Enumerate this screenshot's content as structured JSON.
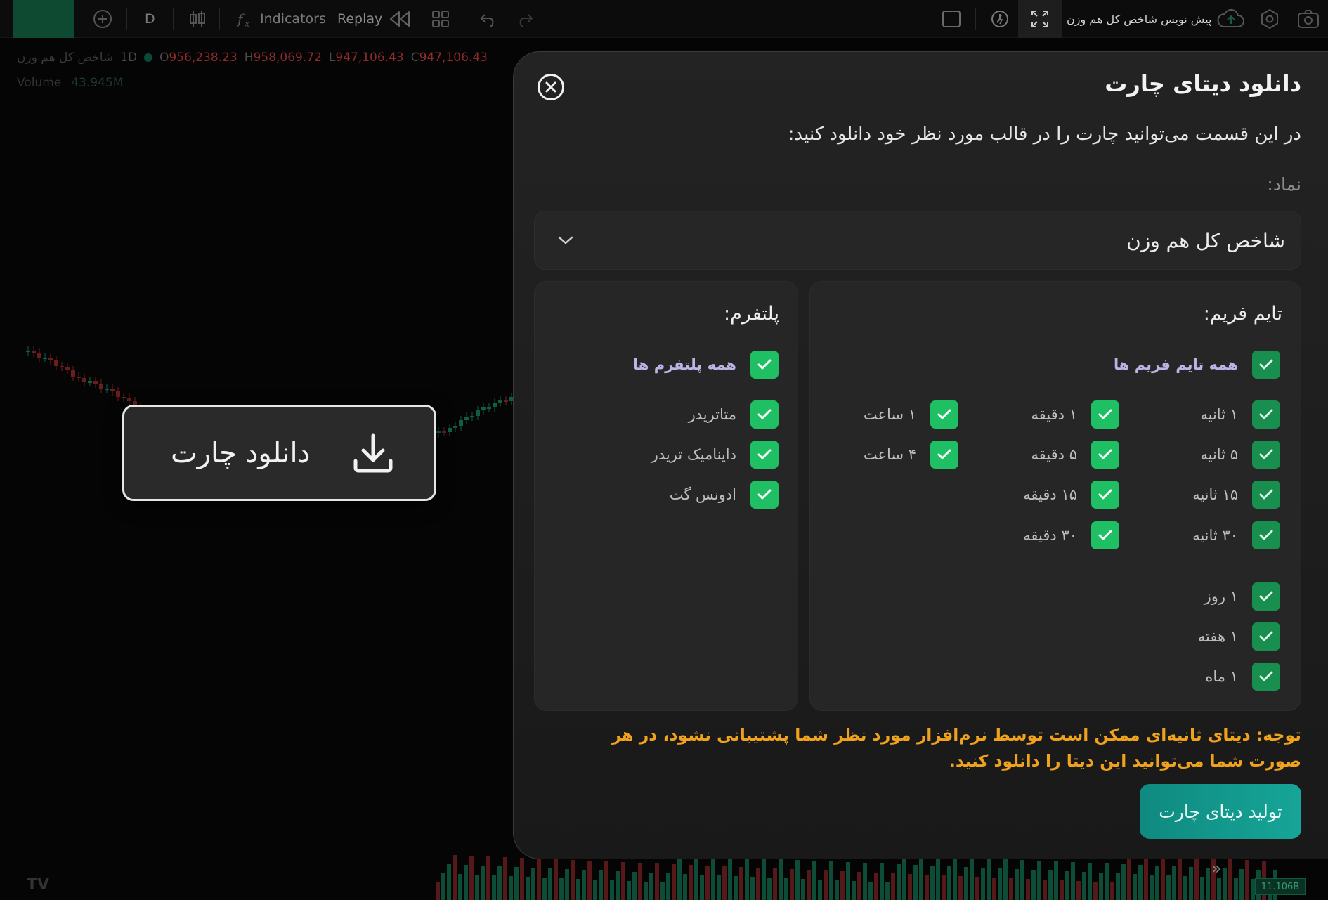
{
  "toolbar": {
    "timeframe": "D",
    "indicators_label": "Indicators",
    "replay_label": "Replay",
    "cloud_title": "پیش نویس شاخص کل هم وزن"
  },
  "legend": {
    "symbol": "شاخص کل هم وزن",
    "interval": "1D",
    "open_label": "O",
    "open": "956,238.23",
    "high_label": "H",
    "high": "958,069.72",
    "low_label": "L",
    "low": "947,106.43",
    "close_label": "C",
    "close": "947,106.43",
    "volume_label": "Volume",
    "volume": "43.945M"
  },
  "axis": {
    "current_value": "11.106B"
  },
  "download_button": {
    "label": "دانلود چارت"
  },
  "panel": {
    "title": "دانلود دیتای چارت",
    "description": "در این قسمت می‌توانید چارت را در قالب مورد نظر خود دانلود کنید:",
    "symbol_label": "نماد:",
    "symbol_value": "شاخص کل هم وزن",
    "timeframe_title": "تایم فریم:",
    "timeframe_all": "همه تایم فریم ها",
    "timeframes": {
      "s1": "۱ ثانیه",
      "s5": "۵ ثانیه",
      "s15": "۱۵ ثانیه",
      "s30": "۳۰ ثانیه",
      "m1": "۱ دقیقه",
      "m5": "۵ دقیقه",
      "m15": "۱۵ دقیقه",
      "m30": "۳۰ دقیقه",
      "h1": "۱ ساعت",
      "h4": "۴ ساعت",
      "d1": "۱ روز",
      "w1": "۱ هفته",
      "mo1": "۱ ماه"
    },
    "platform_title": "پلتفرم:",
    "platform_all": "همه پلتفرم ها",
    "platforms": {
      "metatrader": "متاتریدر",
      "dynamic": "داینامیک تریدر",
      "advance": "ادونس گت"
    },
    "note": "توجه: دیتای ثانیه‌ای ممکن است توسط نرم‌افزار مورد نظر شما پشتیبانی نشود، در هر صورت شما می‌توانید این دیتا را دانلود کنید.",
    "generate_label": "تولید دیتای چارت"
  },
  "colors": {
    "checkbox_green": "#1fbf64",
    "checkbox_dark_green": "#188f4e",
    "note_orange": "#f0a21c",
    "generate_teal": "#13998e",
    "candle_up": "#0f5e44",
    "candle_down": "#6a1d1d"
  }
}
